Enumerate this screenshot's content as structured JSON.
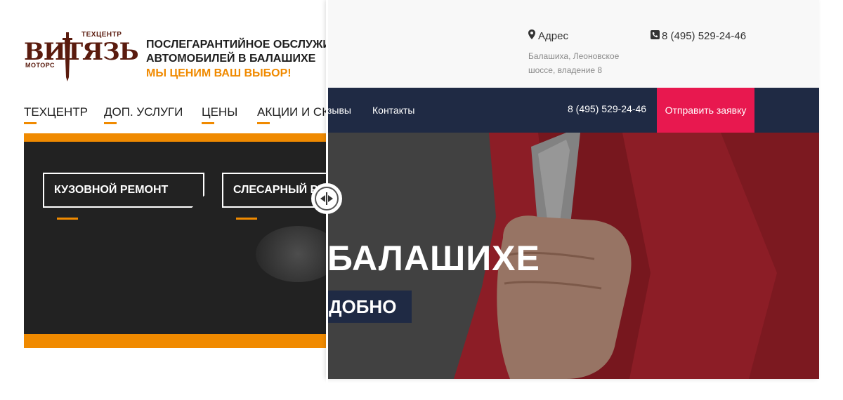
{
  "old_site": {
    "logo": {
      "top": "ТЕХЦЕНТР",
      "brand": "ВИТЯЗЬ",
      "bottom": "МОТОРС"
    },
    "tagline_line1": "ПОСЛЕГАРАНТИЙНОЕ ОБСЛУЖИ",
    "tagline_line2": "АВТОМОБИЛЕЙ В БАЛАШИХЕ",
    "slogan": "МЫ ЦЕНИМ ВАШ ВЫБОР!",
    "nav": [
      "ТЕХЦЕНТР",
      "ДОП. УСЛУГИ",
      "ЦЕНЫ",
      "АКЦИИ И СК"
    ],
    "services": [
      "КУЗОВНОЙ РЕМОНТ",
      "СЛЕСАРНЫЙ РЕ"
    ],
    "accent_color": "#f08a00"
  },
  "new_site": {
    "address_label": "Адрес",
    "address_text": "Балашиха, Леоновское шоссе, владение 8",
    "phone_top": "8 (495) 529-24-46",
    "nav": [
      "зывы",
      "Контакты"
    ],
    "nav_phone": "8 (495) 529-24-46",
    "cta_button": "Отправить заявку",
    "hero_title": "БАЛАШИХЕ",
    "hero_sub": "ДОБНО",
    "navbar_color": "#1f2a44",
    "cta_color": "#e8184f"
  },
  "compare_handle": {
    "icon": "left-right-arrows-icon"
  }
}
